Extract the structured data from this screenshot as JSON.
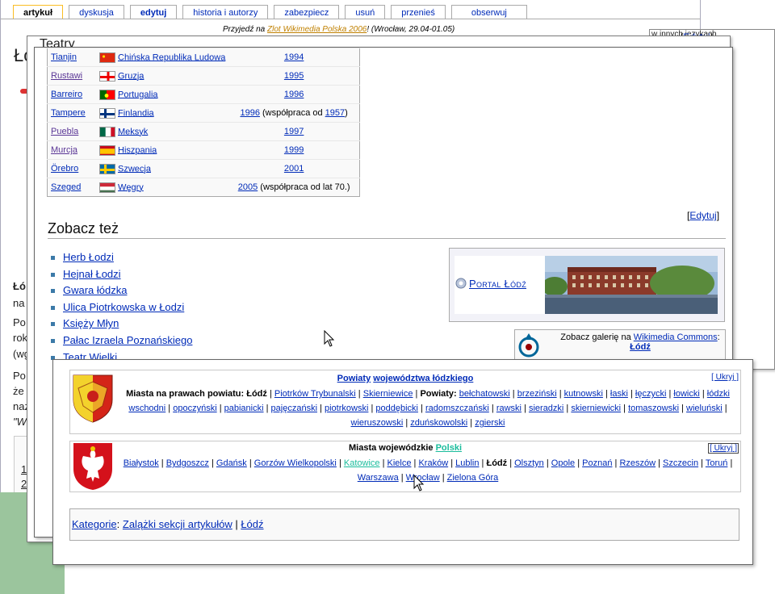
{
  "tabs": [
    {
      "label": "artykuł",
      "selected": true
    },
    {
      "label": "dyskusja"
    },
    {
      "label": "edytuj",
      "bold": true
    },
    {
      "label": "historia i autorzy"
    },
    {
      "label": "zabezpiecz"
    },
    {
      "label": "usuń"
    },
    {
      "label": "przenieś"
    },
    {
      "label": "obserwuj"
    }
  ],
  "notice": {
    "pre": "Przyjedź na ",
    "link": "Zlot Wikimedia Polska 2006",
    "post": "! (Wrocław, 29.04-01.05)"
  },
  "back_fragments": {
    "title": "Łó",
    "bold": "Łó",
    "line1": "na",
    "line2": "Po",
    "line3": "rok",
    "line4": "(wg",
    "line5": "Po",
    "line6": "że",
    "line7": "naz",
    "line8": "\"W",
    "link1": "1",
    "link2": "2",
    "L": "L"
  },
  "mid_window": {
    "title": "Teatry"
  },
  "right_window": {
    "lang_text": "w innych językach",
    "edit_label": "Edytuj"
  },
  "twin_cities": [
    {
      "city": "Tianjin",
      "country": "Chińska Republika Ludowa",
      "flag": "cn",
      "year": "1994",
      "note": ""
    },
    {
      "city": "Rustawi",
      "country": "Gruzja",
      "flag": "ge",
      "year": "1995",
      "note": "",
      "visited": true
    },
    {
      "city": "Barreiro",
      "country": "Portugalia",
      "flag": "pt",
      "year": "1996",
      "note": ""
    },
    {
      "city": "Tampere",
      "country": "Finlandia",
      "flag": "fi",
      "year": "1996",
      "note": " (współpraca od ",
      "note_link": "1957",
      "note_end": ")"
    },
    {
      "city": "Puebla",
      "country": "Meksyk",
      "flag": "mx",
      "year": "1997",
      "note": "",
      "visited": true
    },
    {
      "city": "Murcja",
      "country": "Hiszpania",
      "flag": "es",
      "year": "1999",
      "note": "",
      "visited": true
    },
    {
      "city": "Örebro",
      "country": "Szwecja",
      "flag": "se",
      "year": "2001",
      "note": ""
    },
    {
      "city": "Szeged",
      "country": "Węgry",
      "flag": "hu",
      "year": "2005",
      "note": " (współpraca od lat 70.)"
    }
  ],
  "see_also": {
    "heading": "Zobacz też",
    "edit_label": "Edytuj",
    "items": [
      "Herb Łodzi",
      "Hejnał Łodzi",
      "Gwara łódzka",
      "Ulica Piotrkowska w Łodzi",
      "Księży Młyn",
      "Pałac Izraela Poznańskiego",
      "Teatr Wielki"
    ]
  },
  "portal": {
    "label": "Portal Łódź"
  },
  "commons": {
    "pre": "Zobacz galerię na ",
    "link": "Wikimedia Commons",
    "post": ":",
    "target": "Łódź"
  },
  "navbox1": {
    "title_link1": "Powiaty",
    "title_link2": "województwa łódzkiego",
    "hide": "[ Ukryj ]",
    "cities_label": "Miasta na prawach powiatu:",
    "cities": [
      "Łódź",
      "Piotrków Trybunalski",
      "Skierniewice"
    ],
    "powiaty_label": "Powiaty:",
    "powiaty": [
      "bełchatowski",
      "brzeziński",
      "kutnowski",
      "łaski",
      "łęczycki",
      "łowicki",
      "łódzki wschodni",
      "opoczyński",
      "pabianicki",
      "pajęczański",
      "piotrkowski",
      "poddębicki",
      "radomszczański",
      "rawski",
      "sieradzki",
      "skierniewicki",
      "tomaszowski",
      "wieluński",
      "wieruszowski",
      "zduńskowolski",
      "zgierski"
    ]
  },
  "navbox2": {
    "title_pre": "Miasta wojewódzkie ",
    "title_link": "Polski",
    "hide": "[ Ukryj ]",
    "cities": [
      "Białystok",
      "Bydgoszcz",
      "Gdańsk",
      "Gorzów Wielkopolski",
      "Katowice",
      "Kielce",
      "Kraków",
      "Lublin",
      "Łódź",
      "Olsztyn",
      "Opole",
      "Poznań",
      "Rzeszów",
      "Szczecin",
      "Toruń",
      "Warszawa",
      "Wrocław",
      "Zielona Góra"
    ]
  },
  "categories": {
    "label": "Kategorie",
    "items": [
      "Zalążki sekcji artykułów",
      "Łódź"
    ]
  },
  "colors": {
    "link": "#002bb8",
    "visited": "#5a3696",
    "tab_selected": "#fabd23",
    "green_block": "#9bc59d"
  },
  "icons": [
    "commons-icon",
    "portal-icon",
    "lodz-coat-of-arms-icon",
    "poland-coat-of-arms-icon",
    "mouse-cursor-icon"
  ]
}
